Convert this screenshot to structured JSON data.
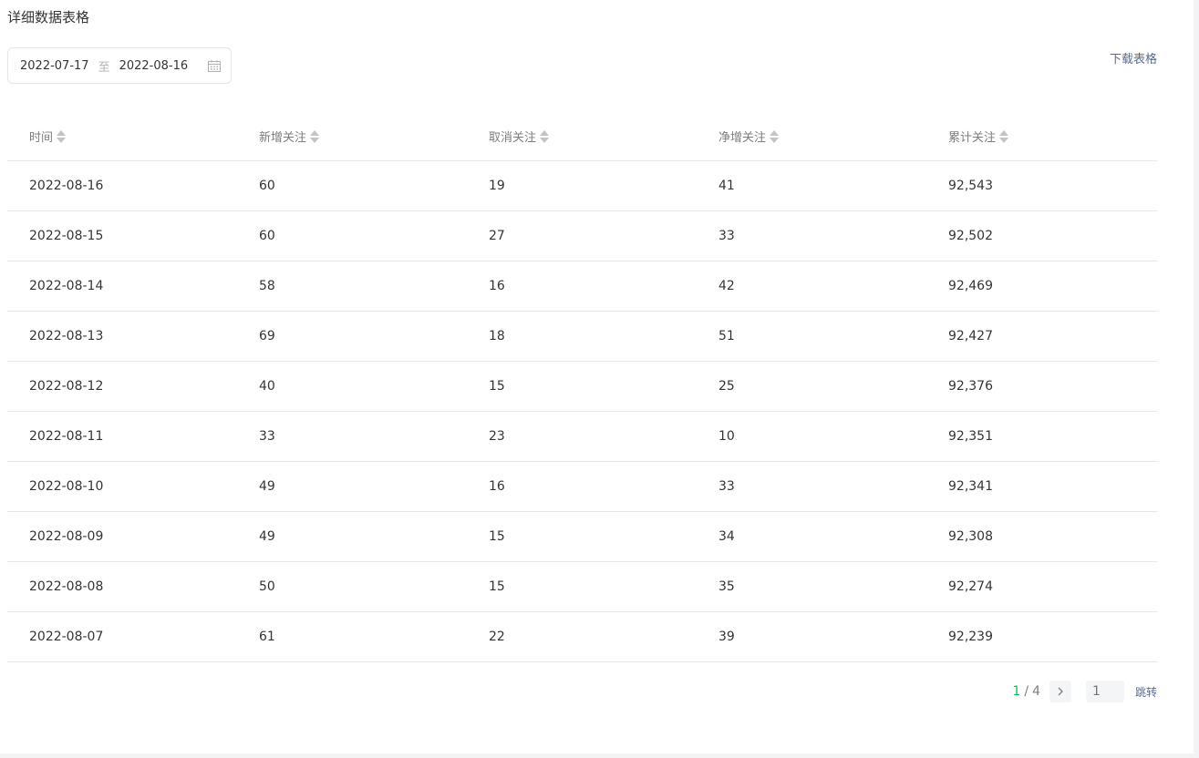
{
  "section_title": "详细数据表格",
  "date_range": {
    "start": "2022-07-17",
    "separator": "至",
    "end": "2022-08-16",
    "icon": "calendar-icon"
  },
  "download_label": "下载表格",
  "table": {
    "columns": [
      "时间",
      "新增关注",
      "取消关注",
      "净增关注",
      "累计关注"
    ],
    "rows": [
      [
        "2022-08-16",
        "60",
        "19",
        "41",
        "92,543"
      ],
      [
        "2022-08-15",
        "60",
        "27",
        "33",
        "92,502"
      ],
      [
        "2022-08-14",
        "58",
        "16",
        "42",
        "92,469"
      ],
      [
        "2022-08-13",
        "69",
        "18",
        "51",
        "92,427"
      ],
      [
        "2022-08-12",
        "40",
        "15",
        "25",
        "92,376"
      ],
      [
        "2022-08-11",
        "33",
        "23",
        "10",
        "92,351"
      ],
      [
        "2022-08-10",
        "49",
        "16",
        "33",
        "92,341"
      ],
      [
        "2022-08-09",
        "49",
        "15",
        "34",
        "92,308"
      ],
      [
        "2022-08-08",
        "50",
        "15",
        "35",
        "92,274"
      ],
      [
        "2022-08-07",
        "61",
        "22",
        "39",
        "92,239"
      ]
    ]
  },
  "pagination": {
    "current": "1",
    "separator": "/",
    "total": "4",
    "input_placeholder": "1",
    "jump_label": "跳转",
    "next_icon": "chevron-right-icon"
  },
  "colors": {
    "accent_green": "#07c160",
    "link_blue": "#576b95",
    "border": "#e7e7eb"
  }
}
